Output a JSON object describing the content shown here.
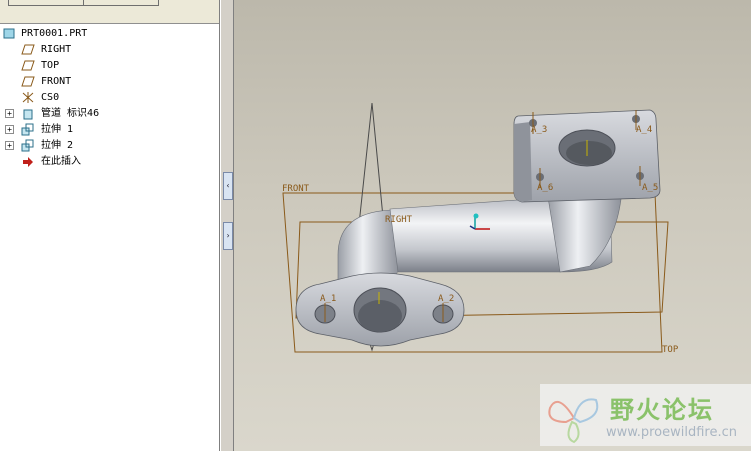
{
  "model_tree": {
    "items": [
      {
        "label": "PRT0001.PRT",
        "icon": "part-icon"
      },
      {
        "label": "RIGHT",
        "icon": "datum-plane-icon"
      },
      {
        "label": "TOP",
        "icon": "datum-plane-icon"
      },
      {
        "label": "FRONT",
        "icon": "datum-plane-icon"
      },
      {
        "label": "CS0",
        "icon": "coordinate-system-icon"
      },
      {
        "label": "管道 标识46",
        "icon": "pipe-feature-icon"
      },
      {
        "label": "拉伸 1",
        "icon": "extrude-icon"
      },
      {
        "label": "拉伸 2",
        "icon": "extrude-icon"
      },
      {
        "label": "在此插入",
        "icon": "insert-here-arrow-icon"
      }
    ],
    "expander_symbol": "+"
  },
  "splitter": {
    "collapse_glyph": "‹",
    "expand_glyph": "›"
  },
  "viewport": {
    "datum_labels": {
      "front": "FRONT",
      "right": "RIGHT",
      "top": "TOP"
    },
    "axis_labels": [
      "A_1",
      "A_2",
      "A_3",
      "A_4",
      "A_5",
      "A_6"
    ],
    "colors": {
      "datum": "#8a5a1a",
      "part_light": "#eceef2",
      "part_dark": "#7f838c"
    }
  },
  "watermark": {
    "title": "野火论坛",
    "url": "www.proewildfire.cn"
  }
}
